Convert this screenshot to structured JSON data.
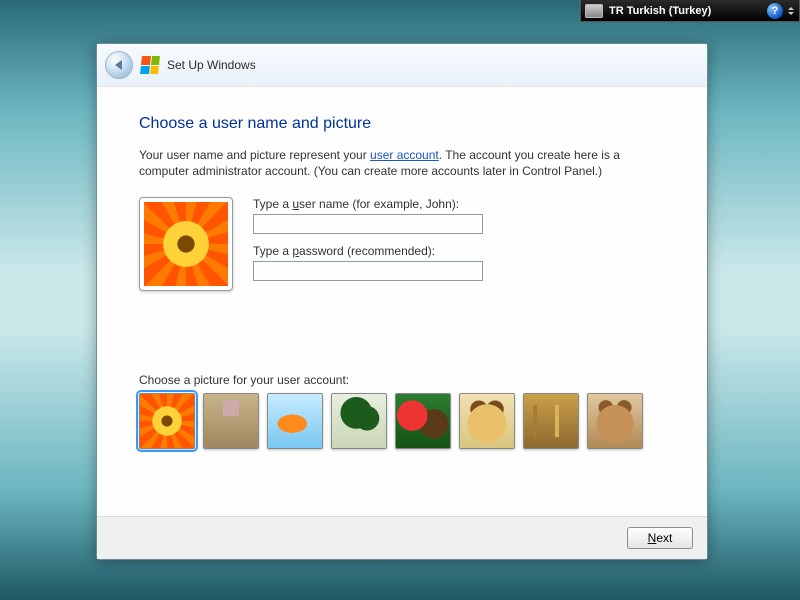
{
  "topbar": {
    "language": "TR Turkish (Turkey)",
    "help_glyph": "?"
  },
  "window": {
    "title": "Set Up Windows"
  },
  "page": {
    "heading": "Choose a user name and picture",
    "intro_before": "Your user name and picture represent your ",
    "intro_link": "user account",
    "intro_after": ". The account you create here is a computer administrator account. (You can create more accounts later in Control Panel.)"
  },
  "form": {
    "username_label_pre": "Type a ",
    "username_label_accel": "u",
    "username_label_post": "ser name (for example, John):",
    "username_value": "",
    "password_label_pre": "Type a ",
    "password_label_accel": "p",
    "password_label_post": "assword (recommended):",
    "password_value": ""
  },
  "picker": {
    "label": "Choose a picture for your user account:",
    "selected_index": 0,
    "items": [
      {
        "name": "flower"
      },
      {
        "name": "robot"
      },
      {
        "name": "fish"
      },
      {
        "name": "bonsai"
      },
      {
        "name": "balls"
      },
      {
        "name": "puppy"
      },
      {
        "name": "chess"
      },
      {
        "name": "kitten"
      }
    ]
  },
  "footer": {
    "next_accel": "N",
    "next_rest": "ext"
  }
}
